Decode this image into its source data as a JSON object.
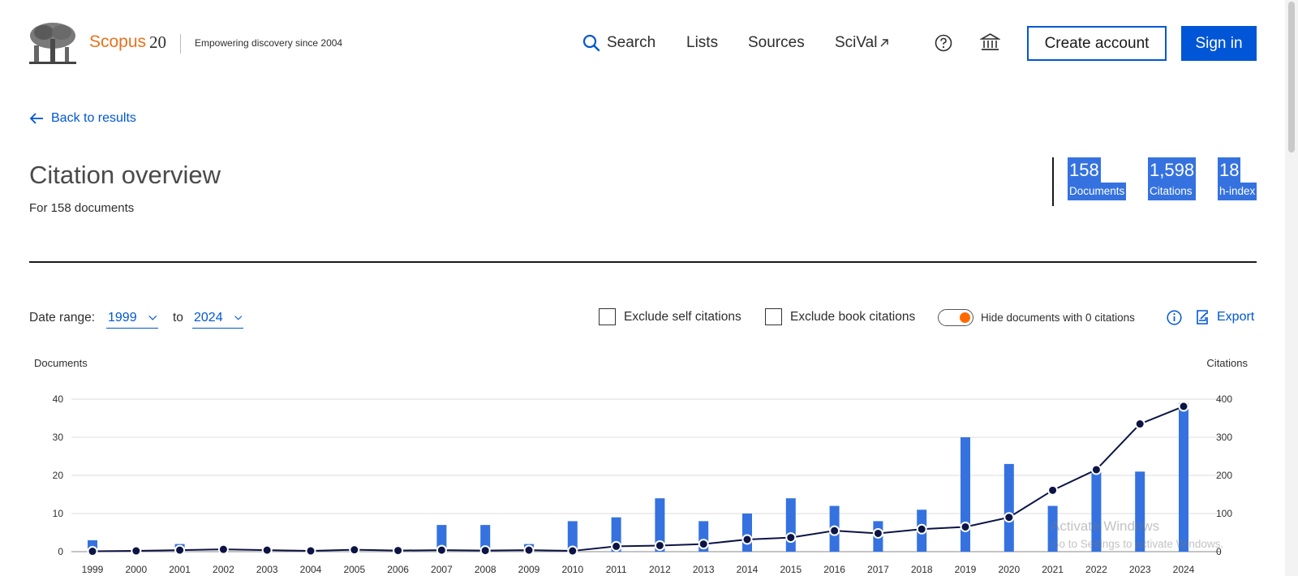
{
  "header": {
    "brand": "Scopus",
    "brand_anniversary": "20",
    "tagline": "Empowering discovery since 2004",
    "nav": {
      "search": "Search",
      "lists": "Lists",
      "sources": "Sources",
      "scival": "SciVal"
    },
    "create_account": "Create account",
    "sign_in": "Sign in"
  },
  "back_link": "Back to results",
  "page": {
    "title": "Citation overview",
    "subtitle": "For 158 documents"
  },
  "metrics": [
    {
      "value": "158",
      "label": "Documents"
    },
    {
      "value": "1,598",
      "label": "Citations"
    },
    {
      "value": "18",
      "label": "h-index"
    }
  ],
  "controls": {
    "date_range_label": "Date range:",
    "from": "1999",
    "to_label": "to",
    "to": "2024",
    "exclude_self": "Exclude self citations",
    "exclude_book": "Exclude book citations",
    "hide_zero": "Hide documents with 0 citations",
    "export": "Export"
  },
  "chart_data": {
    "type": "bar",
    "left_axis_title": "Documents",
    "right_axis_title": "Citations",
    "left_ylim": [
      0,
      40
    ],
    "right_ylim": [
      0,
      400
    ],
    "left_ticks": [
      "0",
      "10",
      "20",
      "30",
      "40"
    ],
    "right_ticks": [
      "0",
      "100",
      "200",
      "300",
      "400"
    ],
    "grid": true,
    "categories": [
      "1999",
      "2000",
      "2001",
      "2002",
      "2003",
      "2004",
      "2005",
      "2006",
      "2007",
      "2008",
      "2009",
      "2010",
      "2011",
      "2012",
      "2013",
      "2014",
      "2015",
      "2016",
      "2017",
      "2018",
      "2019",
      "2020",
      "2021",
      "2022",
      "2023",
      "2024"
    ],
    "series": [
      {
        "values": [
          3,
          0,
          2,
          0,
          0,
          0,
          0,
          0,
          7,
          7,
          2,
          8,
          9,
          14,
          8,
          10,
          14,
          12,
          8,
          11,
          30,
          23,
          12,
          21,
          21,
          39
        ],
        "color": "#3572e0"
      },
      {
        "values": [
          1,
          2,
          4,
          6,
          4,
          2,
          5,
          3,
          4,
          3,
          4,
          2,
          14,
          16,
          20,
          32,
          37,
          55,
          48,
          59,
          65,
          90,
          161,
          215,
          335,
          381
        ],
        "color": "#0c1445"
      }
    ]
  },
  "watermark": {
    "line1": "Activate Windows",
    "line2": "Go to Settings to activate Windows."
  },
  "colors": {
    "brand_orange": "#e9711c",
    "primary_blue": "#0056d6",
    "bar_blue": "#3572e0",
    "line_navy": "#0c1445",
    "toggle_orange": "#ff6a00"
  }
}
